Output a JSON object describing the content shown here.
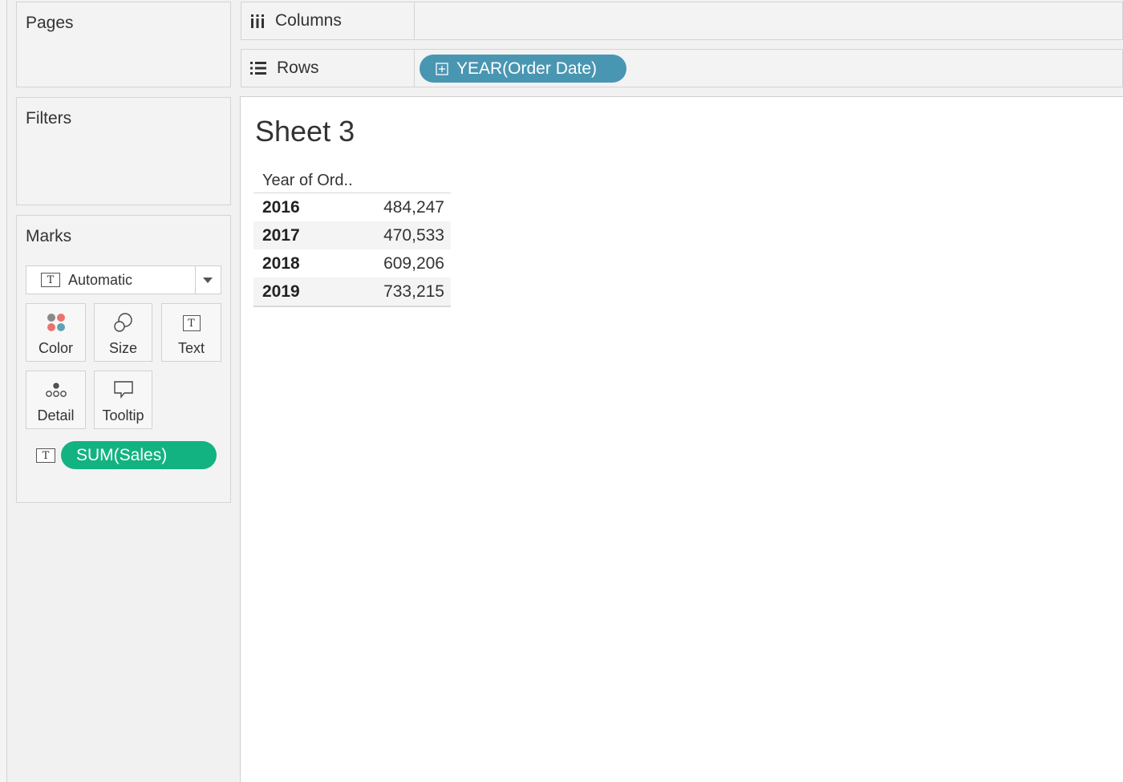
{
  "side": {
    "pages_title": "Pages",
    "filters_title": "Filters",
    "marks": {
      "title": "Marks",
      "mark_type": "Automatic",
      "mark_type_icon": "T",
      "buttons": {
        "color": "Color",
        "size": "Size",
        "text": "Text",
        "detail": "Detail",
        "tooltip": "Tooltip"
      },
      "field_pill": {
        "icon": "T",
        "label": "SUM(Sales)",
        "color": "#12b380"
      }
    }
  },
  "shelves": {
    "columns_label": "Columns",
    "rows_label": "Rows",
    "rows_pill": {
      "label": "YEAR(Order Date)",
      "color": "#4996b2"
    }
  },
  "sheet": {
    "title": "Sheet 3",
    "header": "Year of Ord..",
    "rows": [
      {
        "year": "2016",
        "value": "484,247"
      },
      {
        "year": "2017",
        "value": "470,533"
      },
      {
        "year": "2018",
        "value": "609,206"
      },
      {
        "year": "2019",
        "value": "733,215"
      }
    ]
  }
}
